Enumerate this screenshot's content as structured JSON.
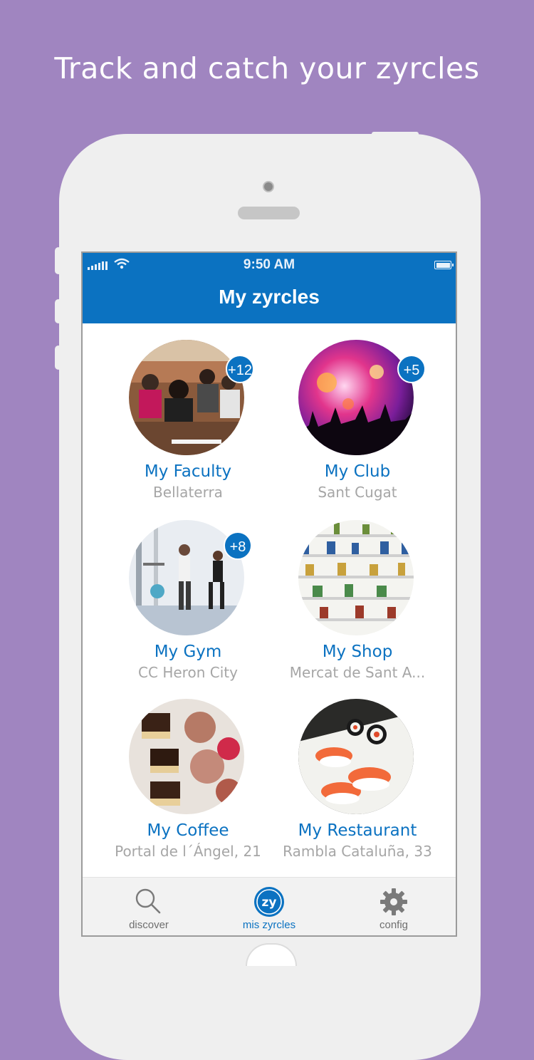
{
  "headline": "Track and catch your zyrcles",
  "status_bar": {
    "time": "9:50 AM"
  },
  "nav": {
    "title": "My zyrcles"
  },
  "zyrcles": [
    {
      "name": "My Faculty",
      "location": "Bellaterra",
      "badge": "+12",
      "image": "lecture-hall-photo"
    },
    {
      "name": "My Club",
      "location": "Sant Cugat",
      "badge": "+5",
      "image": "nightclub-photo"
    },
    {
      "name": "My Gym",
      "location": "CC Heron City",
      "badge": "+8",
      "image": "gym-photo"
    },
    {
      "name": "My Shop",
      "location": "Mercat de Sant A...",
      "badge": "",
      "image": "shop-shelves-photo"
    },
    {
      "name": "My Coffee",
      "location": "Portal de l´Ángel, 21",
      "badge": "",
      "image": "pastries-photo"
    },
    {
      "name": "My Restaurant",
      "location": "Rambla Cataluña, 33",
      "badge": "",
      "image": "sushi-photo"
    }
  ],
  "tabs": [
    {
      "label": "discover",
      "icon": "search-icon",
      "active": false
    },
    {
      "label": "mis zyrcles",
      "icon": "zy-logo-icon",
      "active": true
    },
    {
      "label": "config",
      "icon": "gear-icon",
      "active": false
    }
  ],
  "colors": {
    "background": "#a085c0",
    "accent": "#0b72c1",
    "secondary_text": "#a6a6a6"
  }
}
